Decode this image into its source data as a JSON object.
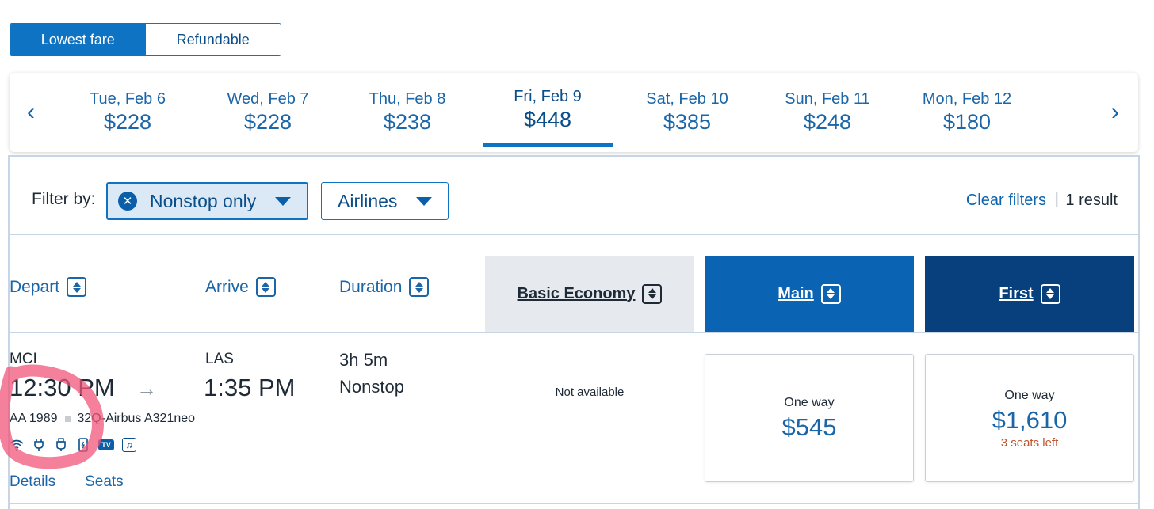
{
  "fare_toggle": {
    "lowest": "Lowest fare",
    "refundable": "Refundable"
  },
  "date_strip": {
    "prev_icon": "chevron-left-icon",
    "next_icon": "chevron-right-icon",
    "dates": [
      {
        "day": "Tue, Feb 6",
        "price": "$228"
      },
      {
        "day": "Wed, Feb 7",
        "price": "$228"
      },
      {
        "day": "Thu, Feb 8",
        "price": "$238"
      },
      {
        "day": "Fri, Feb 9",
        "price": "$448"
      },
      {
        "day": "Sat, Feb 10",
        "price": "$385"
      },
      {
        "day": "Sun, Feb 11",
        "price": "$248"
      },
      {
        "day": "Mon, Feb 12",
        "price": "$180"
      }
    ],
    "selected": "Fri, Feb 9"
  },
  "filters": {
    "label": "Filter by:",
    "nonstop": "Nonstop only",
    "airlines": "Airlines",
    "clear": "Clear filters",
    "separator": "|",
    "result_count": "1 result"
  },
  "columns": {
    "depart": "Depart",
    "arrive": "Arrive",
    "duration": "Duration",
    "basic": "Basic Economy",
    "main": "Main",
    "first": "First"
  },
  "flight": {
    "origin": "MCI",
    "depart_time": "12:30 PM",
    "destination": "LAS",
    "arrive_time": "1:35 PM",
    "flight_number": "AA 1989",
    "aircraft": "32Q-Airbus A321neo",
    "duration": "3h 5m",
    "stops": "Nonstop",
    "amenities": [
      "wifi-icon",
      "power-plug-icon",
      "usb-icon",
      "phone-icon",
      "tv-icon",
      "music-icon"
    ],
    "tv_text": "TV",
    "details_link": "Details",
    "seats_link": "Seats",
    "basic": {
      "status": "Not available"
    },
    "main": {
      "label": "One way",
      "price": "$545"
    },
    "first": {
      "label": "One way",
      "price": "$1,610",
      "seats_left": "3 seats left"
    }
  },
  "colors": {
    "primary": "#0e73c2",
    "main_header": "#0b63b3",
    "first_header": "#08407e",
    "annotation": "#f0557a"
  }
}
